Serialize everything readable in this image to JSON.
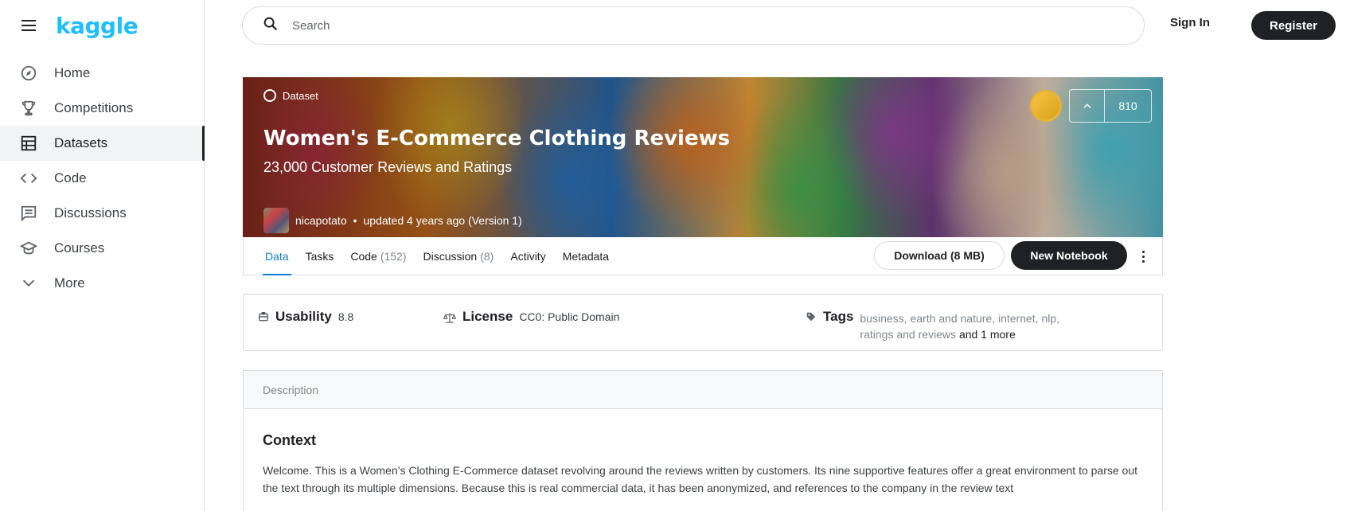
{
  "brand": {
    "logo_text": "kaggle",
    "accent": "#20beff"
  },
  "sidebar": {
    "items": [
      {
        "label": "Home",
        "icon": "compass-icon"
      },
      {
        "label": "Competitions",
        "icon": "trophy-icon"
      },
      {
        "label": "Datasets",
        "icon": "table-icon",
        "active": true
      },
      {
        "label": "Code",
        "icon": "code-icon"
      },
      {
        "label": "Discussions",
        "icon": "comment-icon"
      },
      {
        "label": "Courses",
        "icon": "school-icon"
      },
      {
        "label": "More",
        "icon": "chevron-down-icon"
      }
    ]
  },
  "header": {
    "search_placeholder": "Search",
    "signin_label": "Sign In",
    "register_label": "Register"
  },
  "dataset": {
    "badge": "Dataset",
    "title": "Women's E-Commerce Clothing Reviews",
    "subtitle": "23,000 Customer Reviews and Ratings",
    "author": "nicapotato",
    "bullet": "•",
    "updated": "updated 4 years ago (Version 1)",
    "votes": "810"
  },
  "tabs": [
    {
      "label": "Data",
      "count": "",
      "active": true
    },
    {
      "label": "Tasks",
      "count": ""
    },
    {
      "label": "Code",
      "count": "(152)"
    },
    {
      "label": "Discussion",
      "count": "(8)"
    },
    {
      "label": "Activity",
      "count": ""
    },
    {
      "label": "Metadata",
      "count": ""
    }
  ],
  "actions": {
    "download_label": "Download (8 MB)",
    "new_notebook_label": "New Notebook"
  },
  "meta": {
    "usability_key": "Usability",
    "usability_val": "8.8",
    "license_key": "License",
    "license_val": "CC0: Public Domain",
    "tags_key": "Tags",
    "tags_line1": "business, earth and nature, internet, nlp,",
    "tags_line2": "ratings and reviews",
    "tags_more": "and 1 more"
  },
  "description": {
    "header": "Description",
    "heading": "Context",
    "body": "Welcome. This is a Women’s Clothing E-Commerce dataset revolving around the reviews written by customers. Its nine supportive features offer a great environment to parse out the text through its multiple dimensions. Because this is real commercial data, it has been anonymized, and references to the company in the review text"
  }
}
